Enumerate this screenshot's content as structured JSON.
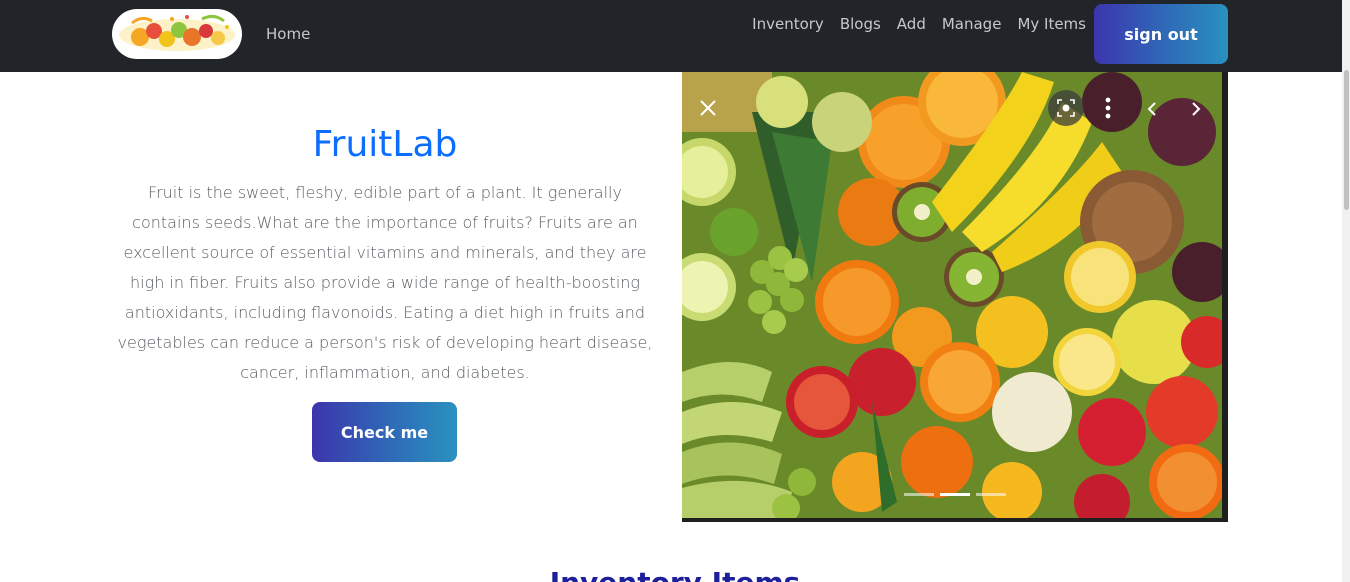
{
  "nav": {
    "logo_icon": "fruit-splash-logo",
    "home": "Home",
    "links": [
      "Inventory",
      "Blogs",
      "Add",
      "Manage",
      "My Items"
    ],
    "signout": "sign out"
  },
  "hero": {
    "title": "FruitLab",
    "text": "Fruit is the sweet, fleshy, edible part of a plant. It generally contains seeds.What are the importance of fruits? Fruits are an excellent source of essential vitamins and minerals, and they are high in fiber. Fruits also provide a wide range of health-boosting antioxidants, including flavonoids. Eating a diet high in fruits and vegetables can reduce a person's risk of developing heart disease, cancer, inflammation, and diabetes.",
    "button": "Check me"
  },
  "carousel": {
    "image": "mixed-fruits-photo",
    "indicator_count": 3,
    "active_indicator": 2,
    "controls": [
      "close-icon",
      "lens-icon",
      "more-icon",
      "prev-icon",
      "next-icon"
    ]
  },
  "section": {
    "heading": "Inventory Items"
  },
  "colors": {
    "navbar": "#212529",
    "title": "#0d6efd",
    "button_gradient_start": "#3d35ad",
    "button_gradient_end": "#2a91bf"
  }
}
